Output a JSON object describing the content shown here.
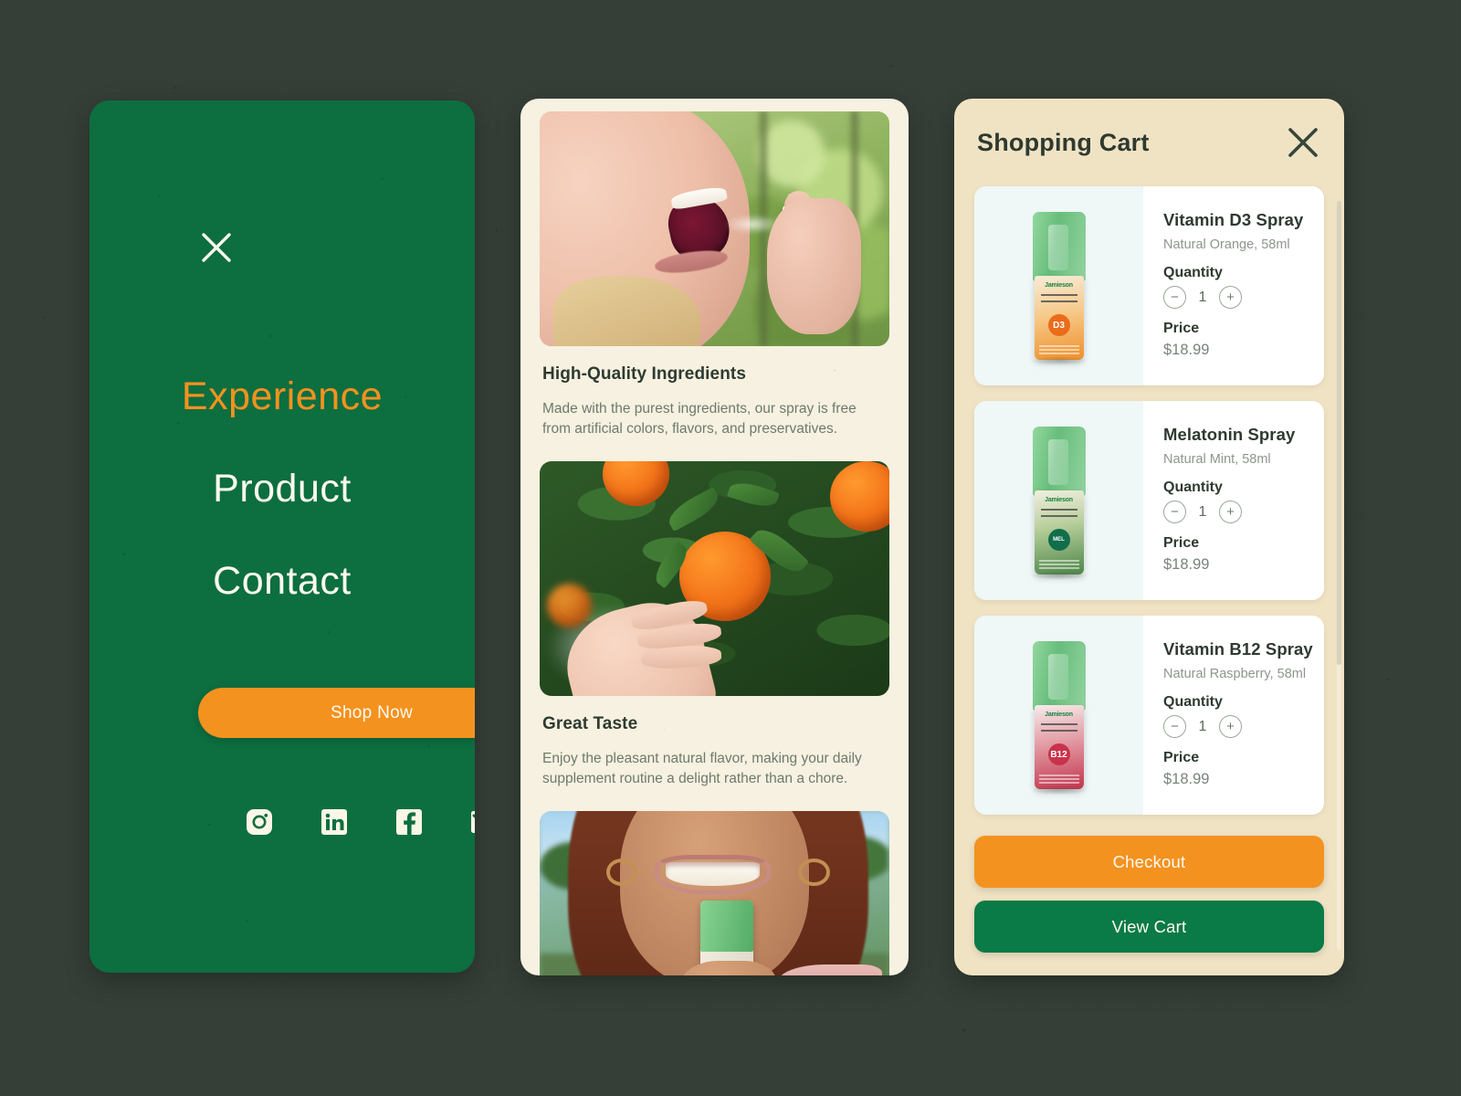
{
  "theme": {
    "backdrop": "#353f37",
    "menu_green": "#0d6e40",
    "accent_orange": "#f4921f",
    "cart_cream": "#f0e3c4",
    "panel_cream": "#f6f1e1",
    "cart_green": "#0a7a46",
    "text_dark": "#2e3a30",
    "text_muted": "#8d968b"
  },
  "menu_panel": {
    "close_label": "close-menu",
    "links": [
      {
        "label": "Experience",
        "active": true
      },
      {
        "label": "Product",
        "active": false
      },
      {
        "label": "Contact",
        "active": false
      }
    ],
    "cta_label": "Shop Now",
    "socials": [
      {
        "name": "instagram-icon",
        "label": "Instagram"
      },
      {
        "name": "linkedin-icon",
        "label": "LinkedIn"
      },
      {
        "name": "facebook-icon",
        "label": "Facebook"
      },
      {
        "name": "email-icon",
        "label": "Email"
      }
    ]
  },
  "feature_panel": {
    "sections": [
      {
        "image_alt": "Woman spraying supplement into her mouth outdoors",
        "title": "High-Quality Ingredients",
        "description": "Made with the purest ingredients, our spray is free from artificial colors, flavors, and preservatives."
      },
      {
        "image_alt": "Hand picking a ripe orange from a tree",
        "title": "Great Taste",
        "description": "Enjoy the pleasant natural flavor, making your daily supplement routine a delight rather than a chore."
      },
      {
        "image_alt": "Smiling woman holding a vitamin spray bottle",
        "title": "",
        "description": ""
      }
    ]
  },
  "cart_panel": {
    "title": "Shopping Cart",
    "close_label": "close-cart",
    "quantity_label": "Quantity",
    "price_label": "Price",
    "decrement_symbol": "−",
    "increment_symbol": "+",
    "items": [
      {
        "name": "Vitamin D3 Spray",
        "variant": "Natural Orange, 58ml",
        "quantity": "1",
        "price": "$18.99",
        "badge": "D3",
        "brand": "Jamieson",
        "variant_class": "d3"
      },
      {
        "name": "Melatonin Spray",
        "variant": "Natural Mint, 58ml",
        "quantity": "1",
        "price": "$18.99",
        "badge": "MEL",
        "brand": "Jamieson",
        "variant_class": "mel"
      },
      {
        "name": "Vitamin B12 Spray",
        "variant": "Natural Raspberry, 58ml",
        "quantity": "1",
        "price": "$18.99",
        "badge": "B12",
        "brand": "Jamieson",
        "variant_class": "b12"
      }
    ],
    "checkout_label": "Checkout",
    "view_cart_label": "View Cart"
  }
}
